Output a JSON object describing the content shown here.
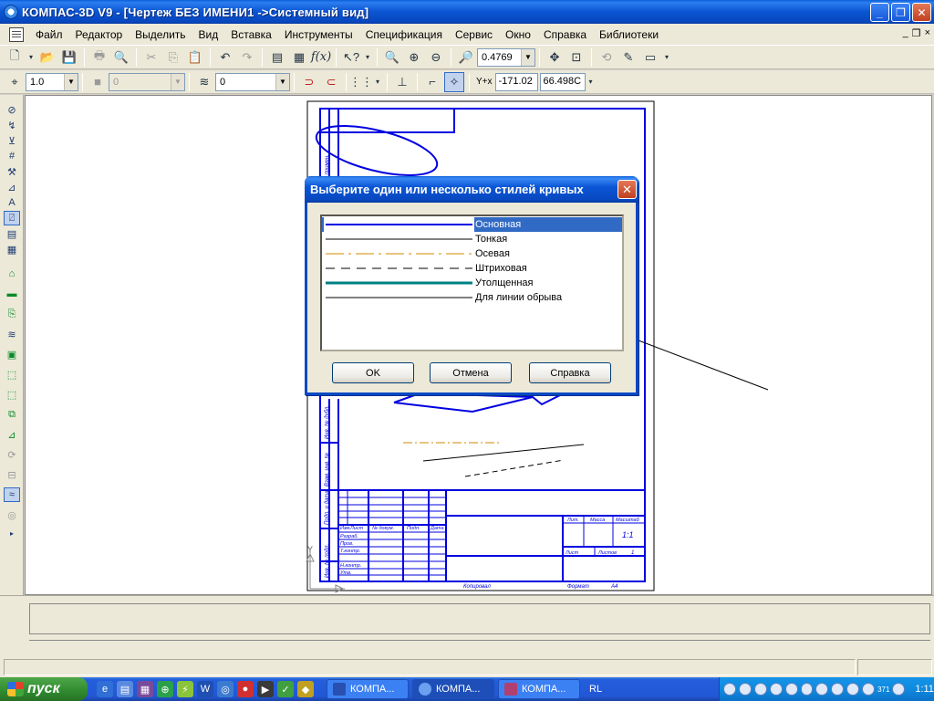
{
  "window": {
    "title": "КОМПАС-3D V9 - [Чертеж БЕЗ ИМЕНИ1 ->Системный вид]",
    "buttons": [
      "_",
      "❐",
      "✕"
    ]
  },
  "menu": {
    "items": [
      "Файл",
      "Редактор",
      "Выделить",
      "Вид",
      "Вставка",
      "Инструменты",
      "Спецификация",
      "Сервис",
      "Окно",
      "Справка",
      "Библиотеки"
    ],
    "mdi_buttons": [
      "_",
      "❐",
      "×"
    ]
  },
  "toolbar1": {
    "zoom_value": "0.4769"
  },
  "toolbar2": {
    "step_value": "1.0",
    "layer_disabled_value": "0",
    "layer_value": "0",
    "coord_label": "Y+x",
    "coord_x": "-171.02",
    "coord_y": "66.498C"
  },
  "drawing": {
    "stamp_developer": "Разраб.",
    "stamp_check": "Пров.",
    "stamp_tcontrol": "Т.контр.",
    "stamp_ncontrol": "Н.контр.",
    "stamp_approved": "Утв.",
    "stamp_lit": "Лит.",
    "stamp_mass": "Масса",
    "stamp_scale": "Масштаб",
    "stamp_sheet": "Лист",
    "stamp_sheets": "Листов",
    "stamp_sheets_value": "1",
    "stamp_scale_value": "1:1",
    "stamp_copied": "Копировал",
    "stamp_format": "Формат",
    "stamp_format_value": "А4",
    "stamp_hdr": [
      "Изм.",
      "Лист",
      "№ докум.",
      "Подп.",
      "Дата"
    ],
    "side_labels": [
      "Перв. примен.",
      "Инв. № подл.",
      "Подп. и дата",
      "Взам. инв. №",
      "Инв. № дубл."
    ],
    "axis_y": "Y"
  },
  "dialog": {
    "title": "Выберите один или несколько стилей кривых",
    "close_glyph": "✕",
    "styles": [
      {
        "label": "Основная",
        "color": "#0000e0",
        "selected": true
      },
      {
        "label": "Тонкая",
        "color": "#000000",
        "selected": false
      },
      {
        "label": "Осевая",
        "color": "#d08a00",
        "selected": false
      },
      {
        "label": "Штриховая",
        "color": "#000000",
        "selected": false
      },
      {
        "label": "Утолщенная",
        "color": "#008080",
        "selected": false
      },
      {
        "label": "Для линии обрыва",
        "color": "#000000",
        "selected": false
      }
    ],
    "ok": "OK",
    "cancel": "Отмена",
    "help": "Справка"
  },
  "taskbar": {
    "start": "пуск",
    "tasks": [
      "КОМПА...",
      "КОМПА...",
      "КОМПА..."
    ],
    "lang": "RL",
    "clock": "1:11",
    "tray_num": "371"
  }
}
